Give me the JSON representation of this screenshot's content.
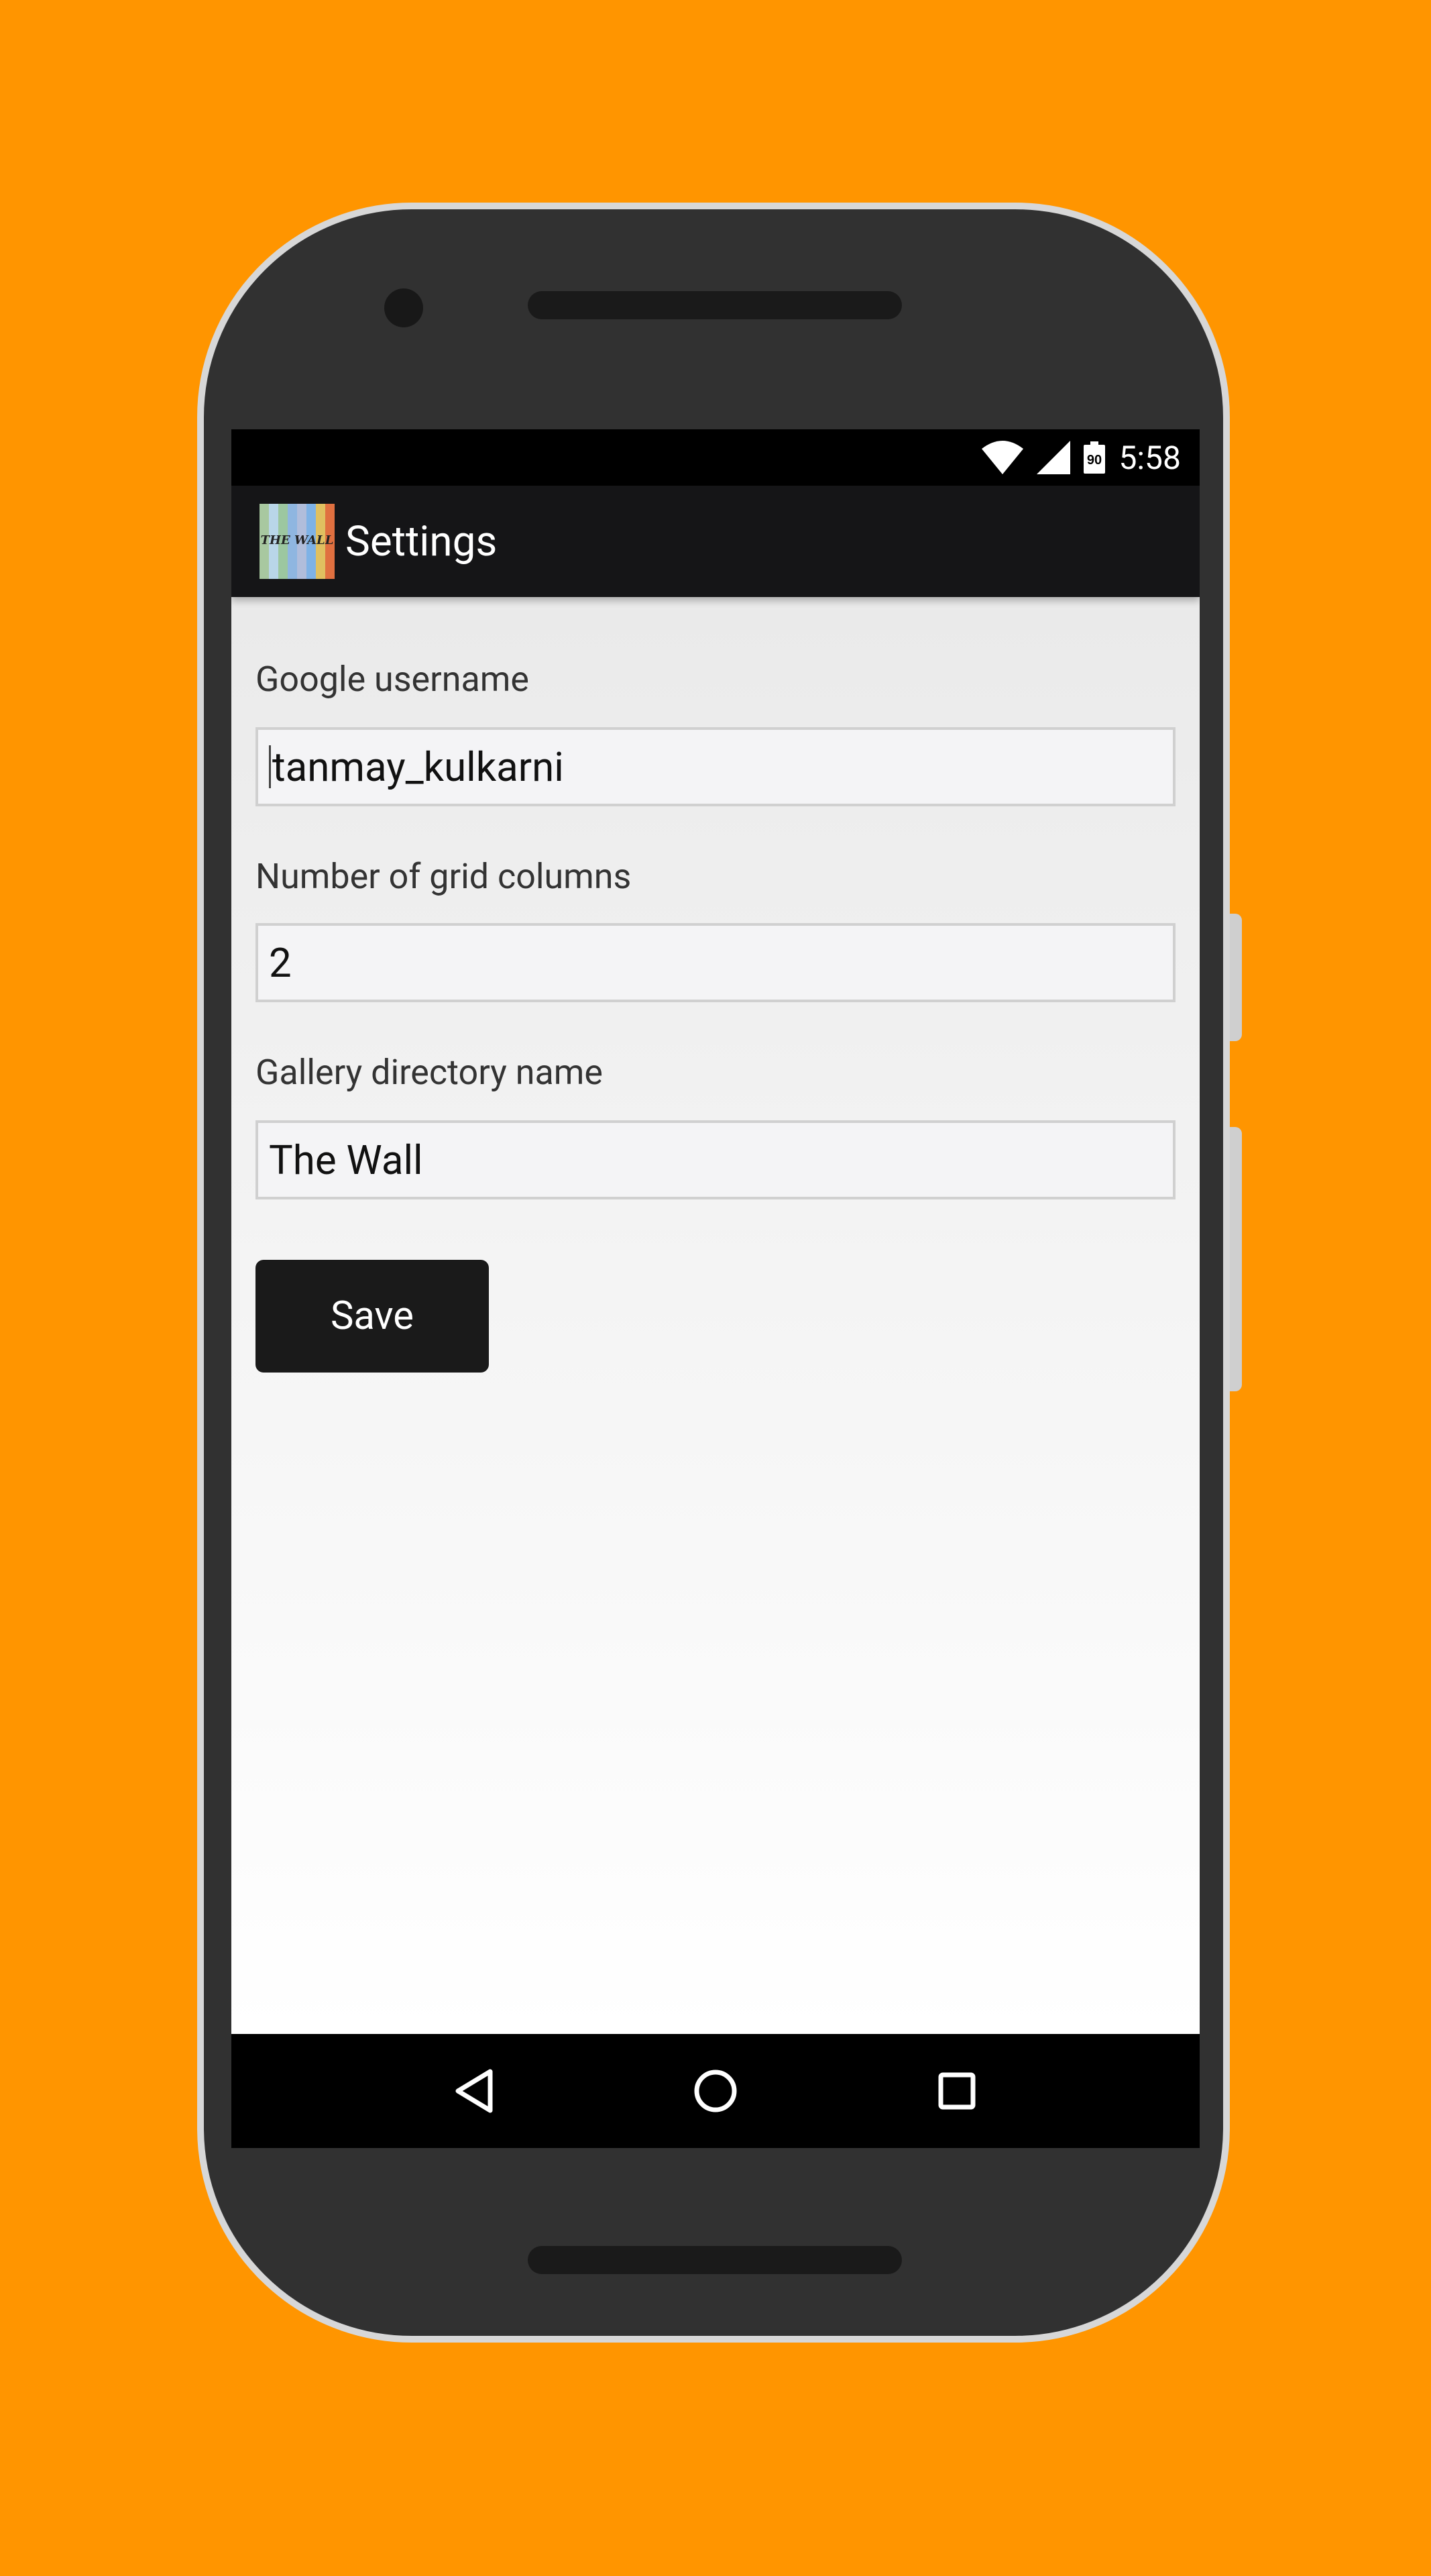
{
  "status_bar": {
    "time": "5:58",
    "battery_level": "90",
    "icons": [
      "wifi-icon",
      "cell-signal-icon",
      "battery-icon"
    ]
  },
  "app_bar": {
    "title": "Settings",
    "app_icon_text": "THE WALL"
  },
  "form": {
    "username": {
      "label": "Google username",
      "value": "tanmay_kulkarni"
    },
    "grid_columns": {
      "label": "Number of grid columns",
      "value": "2"
    },
    "gallery_dir": {
      "label": "Gallery directory name",
      "value": "The Wall"
    },
    "save_label": "Save"
  },
  "navigation": {
    "buttons": [
      "back-icon",
      "home-icon",
      "recents-icon"
    ]
  },
  "colors": {
    "background": "#FF9500",
    "app_bar": "#151517",
    "button": "#1A1A1A"
  }
}
